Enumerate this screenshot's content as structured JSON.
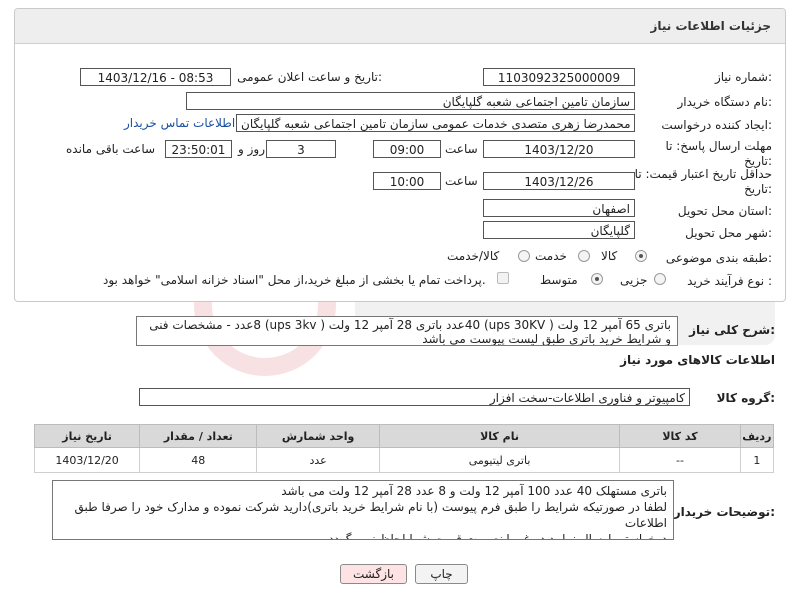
{
  "header": {
    "title": "جزئیات اطلاعات نیاز"
  },
  "fields": {
    "need_number_label": "شماره نیاز:",
    "need_number": "1103092325000009",
    "announce_label": "تاریخ و ساعت اعلان عمومی:",
    "announce_value": "1403/12/16 - 08:53",
    "buyer_label": "نام دستگاه خریدار:",
    "buyer_value": "سازمان تامین اجتماعی شعبه گلپایگان",
    "creator_label": "ایجاد کننده درخواست:",
    "creator_value": "محمدرضا زهری متصدی خدمات عمومی سازمان تامین اجتماعی شعبه گلپایگان",
    "contact_link": "اطلاعات تماس خریدار",
    "deadline_label": "مهلت ارسال پاسخ: تا تاریخ:",
    "deadline_date": "1403/12/20",
    "time_label": "ساعت",
    "deadline_time": "09:00",
    "days_value": "3",
    "days_label": "روز و",
    "remaining_time": "23:50:01",
    "remaining_label": "ساعت باقی مانده",
    "validity_label": "حداقل تاریخ اعتبار قیمت: تا تاریخ:",
    "validity_date": "1403/12/26",
    "validity_time": "10:00",
    "province_label": "استان محل تحویل:",
    "province_value": "اصفهان",
    "city_label": "شهر محل تحویل:",
    "city_value": "گلپایگان",
    "category_label": "طبقه بندی موضوعی:",
    "category_options": [
      "کالا",
      "خدمت",
      "کالا/خدمت"
    ],
    "category_selected": "کالا",
    "process_label": "نوع فرآیند خرید :",
    "process_options": [
      "جزیی",
      "متوسط"
    ],
    "process_selected": "متوسط",
    "payment_note": "پرداخت تمام یا بخشی از مبلغ خرید،از محل \"اسناد خزانه اسلامی\" خواهد بود."
  },
  "summary": {
    "label": "شرح کلی نیاز:",
    "text": "باتری 65 آمپر 12 ولت ( ups 30KV) 40عدد باتری 28 آمپر 12 ولت ( ups 3kv) 8عدد - مشخصات فنی و شرایط خرید باتری طبق لیست پیوست می باشد"
  },
  "goods": {
    "section_title": "اطلاعات کالاهای مورد نیاز",
    "group_label": "گروه کالا:",
    "group_value": "کامپیوتر و فناوری اطلاعات-سخت افزار",
    "columns": [
      "ردیف",
      "کد کالا",
      "نام کالا",
      "واحد شمارش",
      "تعداد / مقدار",
      "تاریخ نیاز"
    ],
    "rows": [
      [
        "1",
        "--",
        "باتری لیتیومی",
        "عدد",
        "48",
        "1403/12/20"
      ]
    ]
  },
  "buyer_notes": {
    "label": "توضیحات خریدار:",
    "lines": [
      "باتری مستهلک 40 عدد 100 آمپر 12 ولت و 8 عدد 28 آمپر 12 ولت می باشد",
      "لطفا در صورتیکه شرایط را طبق فرم پیوست (با نام شرایط خرید باتری)دارید شرکت نموده و مدارک خود را صرفا طبق اطلاعات",
      "درخواستی ارسال نمایید در غیر اینصورت قیمت شما لحاظ نمی گردد"
    ]
  },
  "buttons": {
    "print": "چاپ",
    "back": "بازگشت"
  },
  "colors": {
    "link": "#1a4fa0",
    "back_button_bg": "#fde3e3",
    "header_bg": "#eeeeee",
    "table_header_bg": "#d9d9d9"
  }
}
